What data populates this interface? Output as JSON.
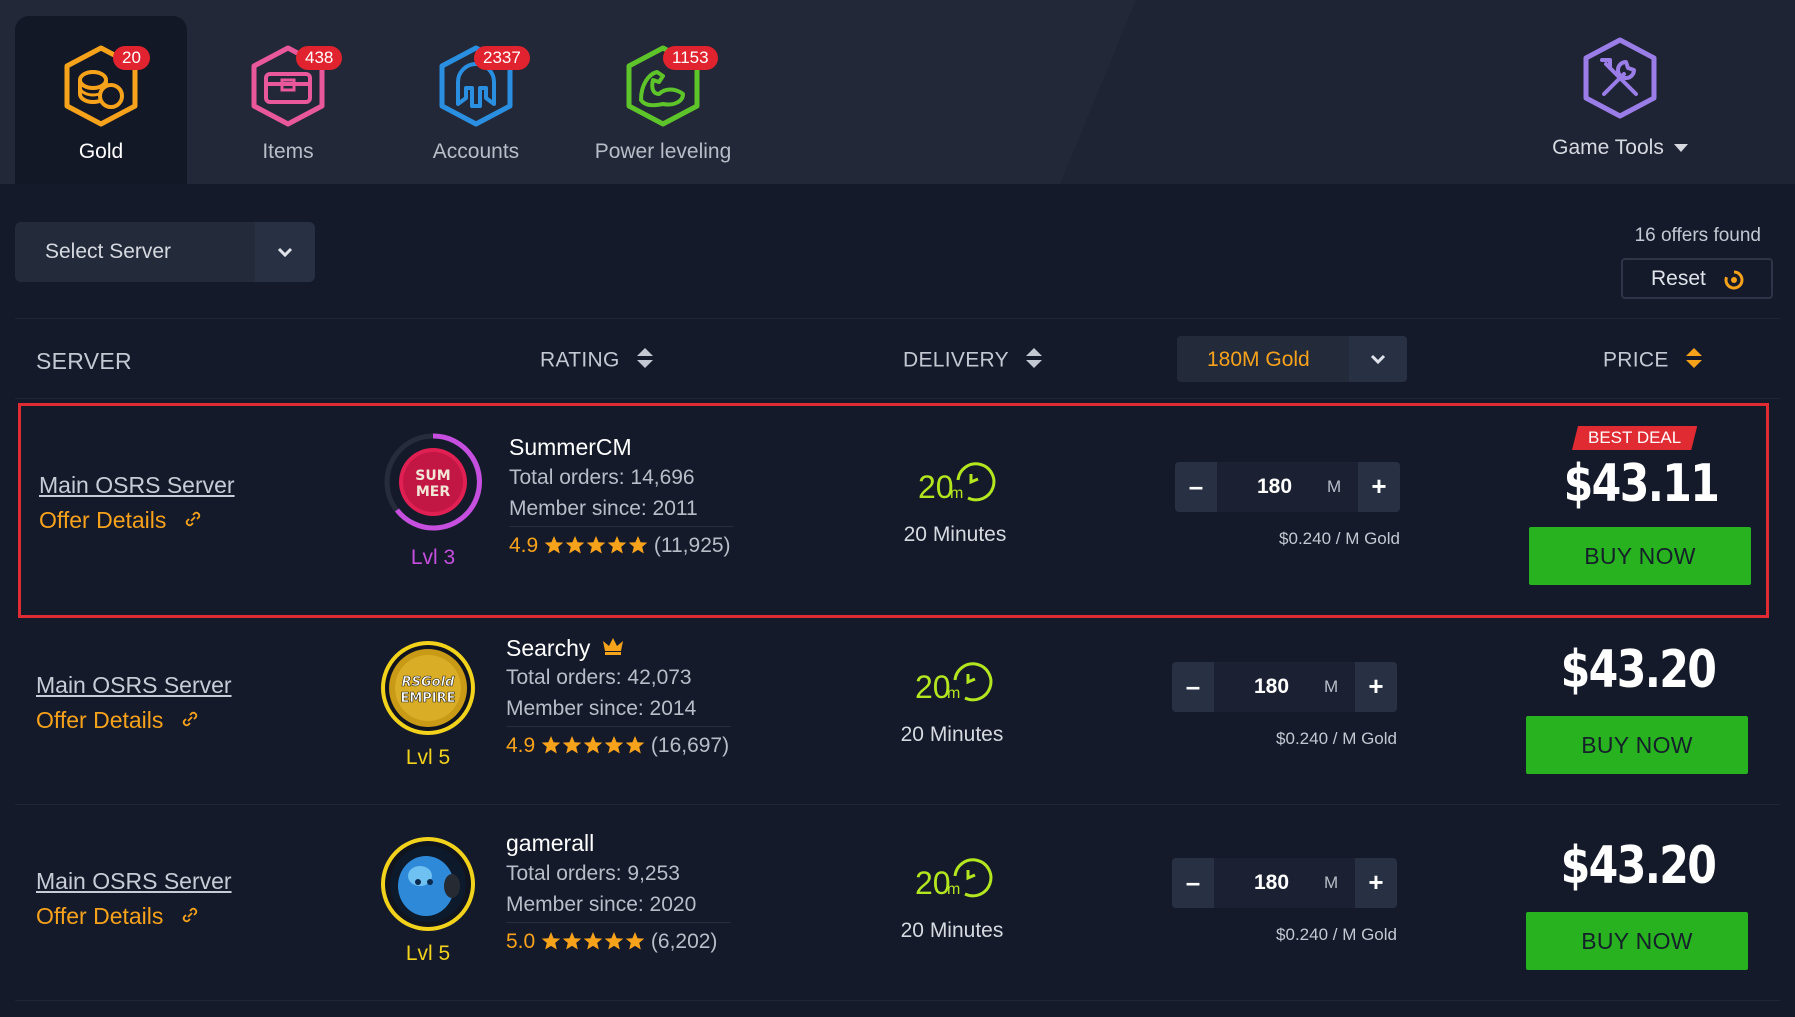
{
  "categories": [
    {
      "label": "Gold",
      "badge": "20",
      "color": "#f7a21b",
      "icon": "gold-coins-icon",
      "active": true
    },
    {
      "label": "Items",
      "badge": "438",
      "color": "#e8589a",
      "icon": "treasure-chest-icon",
      "active": false
    },
    {
      "label": "Accounts",
      "badge": "2337",
      "color": "#2a8fe0",
      "icon": "helmet-icon",
      "active": false
    },
    {
      "label": "Power leveling",
      "badge": "1153",
      "color": "#5dc42a",
      "icon": "flexed-arm-icon",
      "active": false
    }
  ],
  "game_tools": {
    "label": "Game Tools",
    "color": "#9b7de8",
    "icon": "tools-icon"
  },
  "filters": {
    "server_select": "Select Server",
    "offers_found": "16 offers found",
    "reset": "Reset"
  },
  "table_header": {
    "server": "SERVER",
    "rating": "RATING",
    "delivery": "DELIVERY",
    "quantity_select": "180M Gold",
    "price": "PRICE"
  },
  "offers": [
    {
      "server": "Main OSRS Server",
      "offer_details": "Offer Details",
      "level": "Lvl 3",
      "seller": "SummerCM",
      "total_orders": "Total orders: 14,696",
      "member_since": "Member since: 2011",
      "rating": "4.9",
      "rating_count": "(11,925)",
      "delivery_badge": "20",
      "delivery": "20 Minutes",
      "quantity": "180",
      "unit": "M",
      "unit_price": "$0.240 / M Gold",
      "badge": "BEST DEAL",
      "price": "$43.11",
      "buy": "BUY NOW",
      "avatar_text": "SUM MER"
    },
    {
      "server": "Main OSRS Server",
      "offer_details": "Offer Details",
      "level": "Lvl 5",
      "seller": "Searchy",
      "total_orders": "Total orders: 42,073",
      "member_since": "Member since: 2014",
      "rating": "4.9",
      "rating_count": "(16,697)",
      "delivery_badge": "20",
      "delivery": "20 Minutes",
      "quantity": "180",
      "unit": "M",
      "unit_price": "$0.240 / M Gold",
      "price": "$43.20",
      "buy": "BUY NOW",
      "avatar_text": "RSGold EMPIRE"
    },
    {
      "server": "Main OSRS Server",
      "offer_details": "Offer Details",
      "level": "Lvl 5",
      "seller": "gamerall",
      "total_orders": "Total orders: 9,253",
      "member_since": "Member since: 2020",
      "rating": "5.0",
      "rating_count": "(6,202)",
      "delivery_badge": "20",
      "delivery": "20 Minutes",
      "quantity": "180",
      "unit": "M",
      "unit_price": "$0.240 / M Gold",
      "price": "$43.20",
      "buy": "BUY NOW"
    }
  ],
  "colors": {
    "accent": "#f7a21b",
    "buy": "#28b21f",
    "best_deal": "#e02b33",
    "delivery": "#b3e61e",
    "level_purple": "#c64fe0",
    "level_yellow": "#f3d21c"
  }
}
